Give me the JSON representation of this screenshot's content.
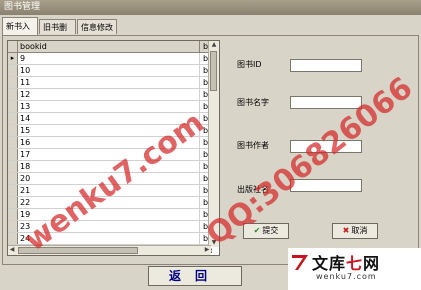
{
  "window": {
    "title": "图书管理"
  },
  "tabs": [
    {
      "label": "新书入库",
      "active": true
    },
    {
      "label": "旧书删除",
      "active": false
    },
    {
      "label": "信息修改",
      "active": false
    }
  ],
  "grid": {
    "columns": [
      "bookid",
      "bookn"
    ],
    "rows": [
      {
        "indicator": "▸",
        "id": "9",
        "name": "bo"
      },
      {
        "indicator": "",
        "id": "10",
        "name": "bookr"
      },
      {
        "indicator": "",
        "id": "11",
        "name": "bookr"
      },
      {
        "indicator": "",
        "id": "12",
        "name": "bookr"
      },
      {
        "indicator": "",
        "id": "13",
        "name": "bookr"
      },
      {
        "indicator": "",
        "id": "14",
        "name": "bookr"
      },
      {
        "indicator": "",
        "id": "15",
        "name": "bookr"
      },
      {
        "indicator": "",
        "id": "16",
        "name": "bookr"
      },
      {
        "indicator": "",
        "id": "17",
        "name": "bookr"
      },
      {
        "indicator": "",
        "id": "18",
        "name": "bookr"
      },
      {
        "indicator": "",
        "id": "20",
        "name": "bookr"
      },
      {
        "indicator": "",
        "id": "21",
        "name": "bookr"
      },
      {
        "indicator": "",
        "id": "22",
        "name": "bookr"
      },
      {
        "indicator": "",
        "id": "19",
        "name": "bookr"
      },
      {
        "indicator": "",
        "id": "23",
        "name": "bookr"
      },
      {
        "indicator": "",
        "id": "24",
        "name": "bookr"
      },
      {
        "indicator": "",
        "id": "33",
        "name": "bookr"
      },
      {
        "indicator": "*",
        "id": "",
        "name": ""
      }
    ]
  },
  "form": {
    "book_id_label": "图书ID",
    "book_name_label": "图书名字",
    "book_author_label": "图书作者",
    "publisher_label": "出版社名",
    "book_id_value": "",
    "book_name_value": "",
    "book_author_value": "",
    "publisher_value": ""
  },
  "buttons": {
    "submit_label": "提交",
    "submit_icon": "✔",
    "cancel_label": "取消",
    "cancel_icon": "✖",
    "back_label": "返回"
  },
  "brand": {
    "name_prefix": "文库",
    "name_mid": "七",
    "name_suffix": "网",
    "url": "wenku7.com"
  },
  "watermark": {
    "site": "wenku7.com",
    "qq": "QQ:306826066"
  },
  "colors": {
    "watermark": "#d62828",
    "back_text": "#000080",
    "brand_red": "#c8141e",
    "submit_icon": "#2a8a2a",
    "cancel_icon": "#c02020"
  }
}
